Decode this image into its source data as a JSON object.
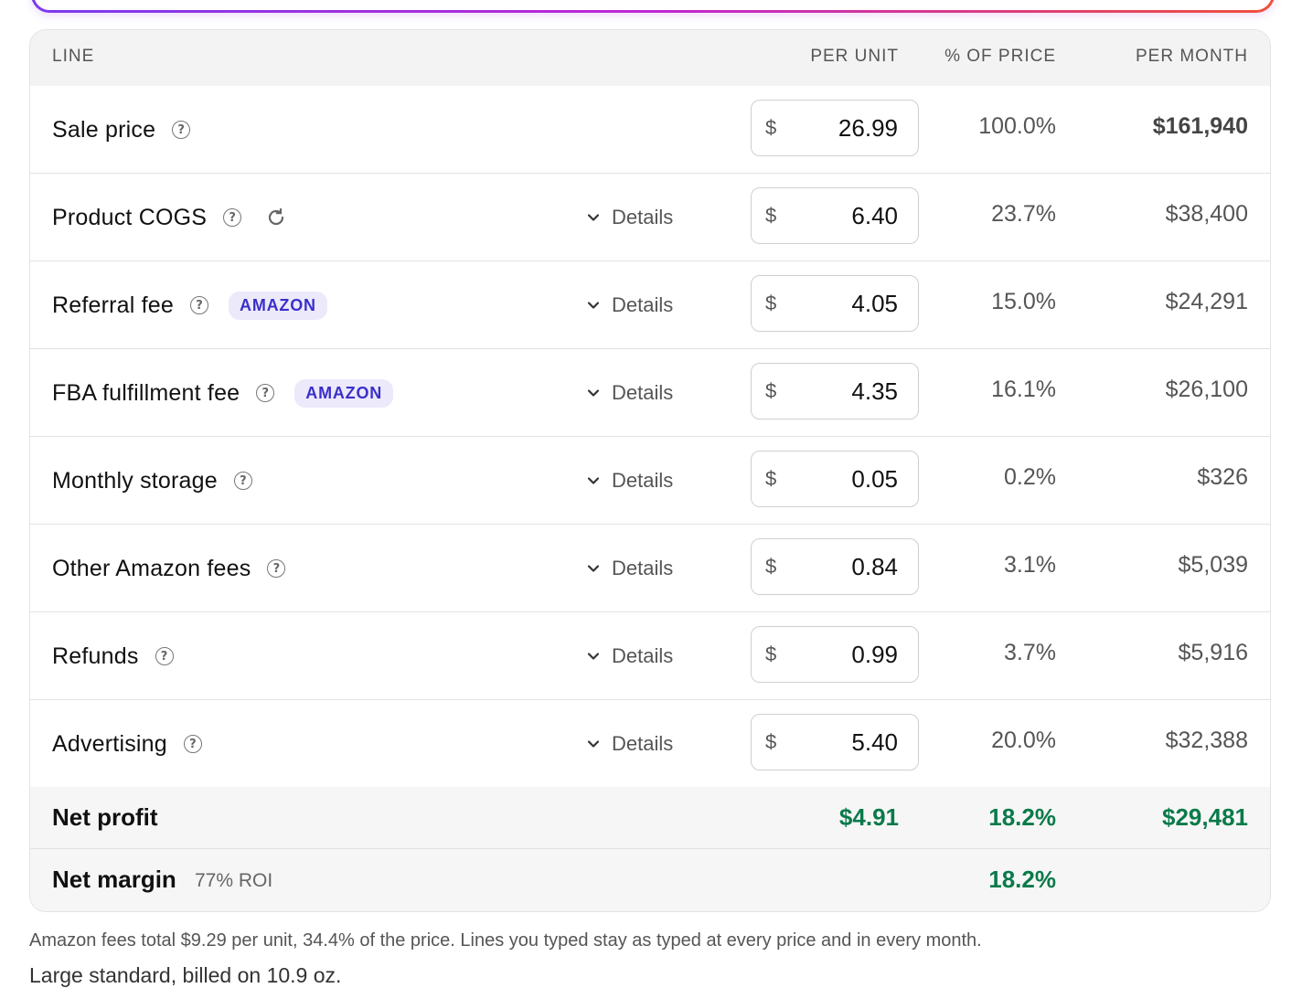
{
  "header": {
    "line": "LINE",
    "per_unit": "PER UNIT",
    "pct_of_price": "% OF PRICE",
    "per_month": "PER MONTH"
  },
  "currency_symbol": "$",
  "details_label": "Details",
  "rows": [
    {
      "label": "Sale price",
      "per_unit": "26.99",
      "pct": "100.0%",
      "per_month": "$161,940"
    },
    {
      "label": "Product COGS",
      "per_unit": "6.40",
      "pct": "23.7%",
      "per_month": "$38,400"
    },
    {
      "label": "Referral fee",
      "badge": "AMAZON",
      "per_unit": "4.05",
      "pct": "15.0%",
      "per_month": "$24,291"
    },
    {
      "label": "FBA fulfillment fee",
      "badge": "AMAZON",
      "per_unit": "4.35",
      "pct": "16.1%",
      "per_month": "$26,100"
    },
    {
      "label": "Monthly storage",
      "per_unit": "0.05",
      "pct": "0.2%",
      "per_month": "$326"
    },
    {
      "label": "Other Amazon fees",
      "per_unit": "0.84",
      "pct": "3.1%",
      "per_month": "$5,039"
    },
    {
      "label": "Refunds",
      "per_unit": "0.99",
      "pct": "3.7%",
      "per_month": "$5,916"
    },
    {
      "label": "Advertising",
      "per_unit": "5.40",
      "pct": "20.0%",
      "per_month": "$32,388"
    }
  ],
  "net_profit": {
    "label": "Net profit",
    "per_unit": "$4.91",
    "pct": "18.2%",
    "per_month": "$29,481"
  },
  "net_margin": {
    "label": "Net margin",
    "roi": "77% ROI",
    "pct": "18.2%"
  },
  "footnote": "Amazon fees total $9.29 per unit, 34.4% of the price. Lines you typed stay as typed at every price and in every month.",
  "footnote2": "Large standard, billed on 10.9 oz.",
  "colors": {
    "profit_green": "#0b7a4a",
    "badge_bg": "#ece9fb",
    "badge_text": "#3b2fc9"
  }
}
